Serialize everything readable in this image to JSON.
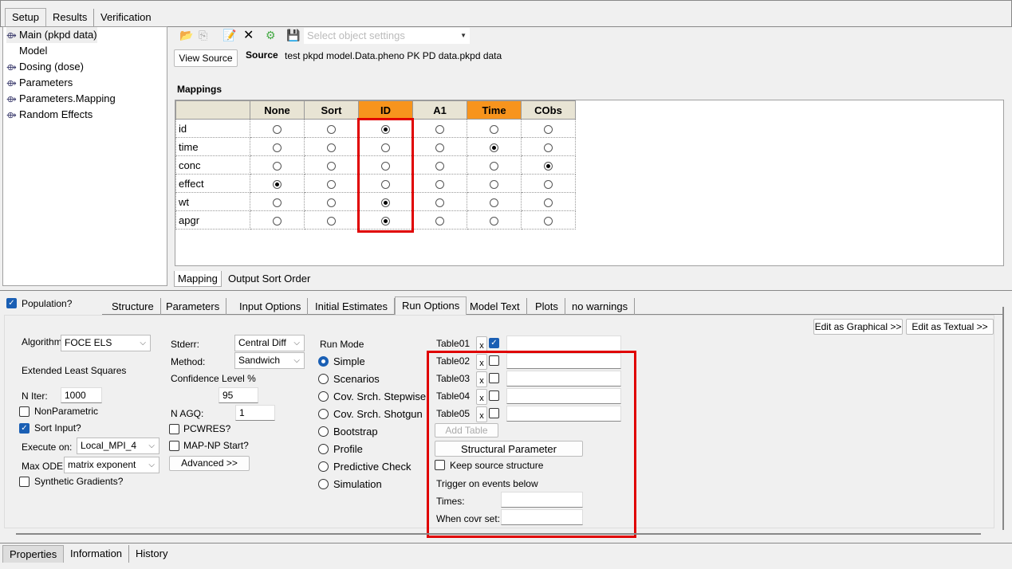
{
  "top_tabs": [
    "Setup",
    "Results",
    "Verification"
  ],
  "tree": [
    "Main (pkpd data)",
    "Model",
    "Dosing (dose)",
    "Parameters",
    "Parameters.Mapping",
    "Random Effects"
  ],
  "toolbar": {
    "select_placeholder": "Select object settings",
    "view_source": "View Source",
    "source_label": "Source",
    "source_value": "test pkpd model.Data.pheno PK PD data.pkpd data"
  },
  "mappings": {
    "title": "Mappings",
    "columns": [
      "None",
      "Sort",
      "ID",
      "A1",
      "Time",
      "CObs"
    ],
    "highlighted_columns": [
      "ID",
      "Time"
    ],
    "rows": [
      {
        "name": "id",
        "selected": "ID"
      },
      {
        "name": "time",
        "selected": "Time"
      },
      {
        "name": "conc",
        "selected": "CObs"
      },
      {
        "name": "effect",
        "selected": "None"
      },
      {
        "name": "wt",
        "selected": "ID"
      },
      {
        "name": "apgr",
        "selected": "ID"
      }
    ],
    "bottom_tabs": [
      "Mapping",
      "Output Sort Order"
    ]
  },
  "population": {
    "label": "Population?",
    "checked": true
  },
  "model_tabs": [
    "Structure",
    "Parameters",
    "Input Options",
    "Initial Estimates",
    "Run Options",
    "Model Text",
    "Plots",
    "no warnings"
  ],
  "active_model_tab": "Run Options",
  "edit_graphical": "Edit as Graphical >>",
  "edit_textual": "Edit as Textual >>",
  "run": {
    "algorithm_label": "Algorithm",
    "algorithm": "FOCE ELS",
    "algorithm_desc": "Extended Least Squares",
    "niter_label": "N Iter:",
    "niter": "1000",
    "nonparametric": "NonParametric",
    "sort_input": "Sort Input?",
    "execute_label": "Execute on:",
    "execute": "Local_MPI_4",
    "maxode_label": "Max ODE:",
    "maxode": "matrix exponent",
    "synthetic": "Synthetic Gradients?",
    "stderr_label": "Stderr:",
    "stderr": "Central Diff",
    "method_label": "Method:",
    "method": "Sandwich",
    "conf_label": "Confidence Level %",
    "conf": "95",
    "nagq_label": "N AGQ:",
    "nagq": "1",
    "pcwres": "PCWRES?",
    "mapnp": "MAP-NP Start?",
    "advanced": "Advanced >>",
    "run_mode_label": "Run Mode",
    "run_modes": [
      "Simple",
      "Scenarios",
      "Cov. Srch. Stepwise",
      "Cov. Srch. Shotgun",
      "Bootstrap",
      "Profile",
      "Predictive Check",
      "Simulation"
    ],
    "run_mode_selected": "Simple"
  },
  "tables": [
    {
      "name": "Table01",
      "checked": true,
      "x": "x"
    },
    {
      "name": "Table02",
      "checked": false,
      "x": "x"
    },
    {
      "name": "Table03",
      "checked": false,
      "x": "x"
    },
    {
      "name": "Table04",
      "checked": false,
      "x": "x"
    },
    {
      "name": "Table05",
      "checked": false,
      "x": "x"
    }
  ],
  "add_table": "Add Table",
  "structural_parameter": "Structural Parameter",
  "keep_source": "Keep source structure",
  "trigger_label": "Trigger on events below",
  "times_label": "Times:",
  "covr_label": "When covr set:",
  "footer_tabs": [
    "Properties",
    "Information",
    "History"
  ],
  "colors": {
    "highlight": "#f7941d",
    "annotation_red": "#e00000",
    "accent": "#1a5fb4"
  }
}
